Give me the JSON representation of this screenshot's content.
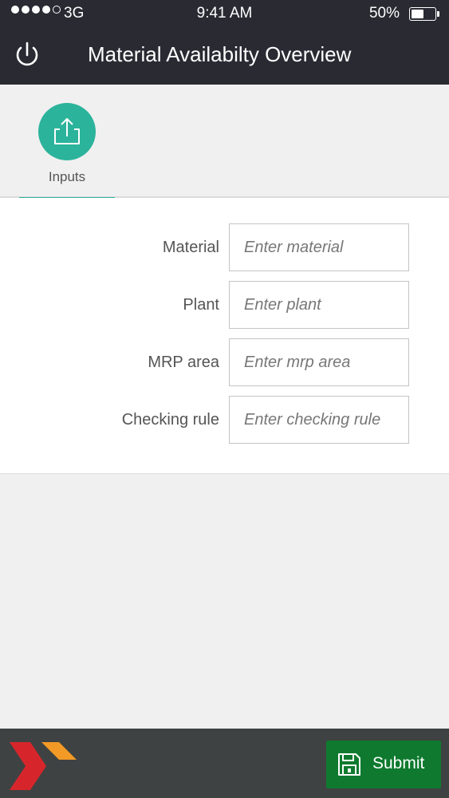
{
  "status_bar": {
    "carrier": "3G",
    "time": "9:41 AM",
    "battery_percent": "50%",
    "battery_level": 0.5,
    "signal_bars_filled": 4,
    "signal_bars_total": 5
  },
  "header": {
    "title": "Material Availabilty Overview",
    "power_icon": "power-icon"
  },
  "tabs": [
    {
      "label": "Inputs",
      "icon": "upload-icon",
      "selected": true
    }
  ],
  "form": {
    "fields": [
      {
        "label": "Material",
        "placeholder": "Enter material",
        "value": ""
      },
      {
        "label": "Plant",
        "placeholder": "Enter plant",
        "value": ""
      },
      {
        "label": "MRP area",
        "placeholder": "Enter mrp area",
        "value": ""
      },
      {
        "label": "Checking rule",
        "placeholder": "Enter checking rule",
        "value": ""
      }
    ]
  },
  "footer": {
    "logo_icon": "brand-logo-icon",
    "submit_label": "Submit",
    "submit_icon": "save-icon"
  },
  "colors": {
    "header_bg": "#2a2a33",
    "accent": "#2bb39b",
    "submit_bg": "#0f7a2f",
    "footer_bg": "#3f4242",
    "logo_red": "#d7262b",
    "logo_orange": "#f39a26"
  }
}
